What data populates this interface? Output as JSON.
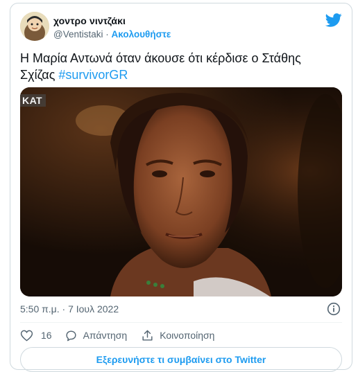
{
  "author": {
    "name": "χοντρο νιντζάκι",
    "handle": "@Ventistaki",
    "separator": "·",
    "follow_label": "Ακολουθήστε"
  },
  "tweet": {
    "text": "Η Μαρία Αντωνά όταν άκουσε ότι κέρδισε ο Στάθης Σχίζας",
    "hashtag": "#survivorGR",
    "timestamp": "5:50 π.μ. · 7 Ιουλ 2022",
    "media_watermark": "ΚΑΤ"
  },
  "actions": {
    "like_count": "16",
    "reply_label": "Απάντηση",
    "share_label": "Κοινοποίηση"
  },
  "footer": {
    "explore_label": "Εξερευνήστε τι συμβαίνει στο Twitter"
  },
  "colors": {
    "accent": "#1d9bf0",
    "secondary_text": "#536471",
    "border": "#cfd9de"
  },
  "icons": {
    "brand": "twitter-bird-icon",
    "info": "info-icon",
    "like": "heart-icon",
    "reply": "speech-bubble-icon",
    "share": "share-upload-icon"
  }
}
